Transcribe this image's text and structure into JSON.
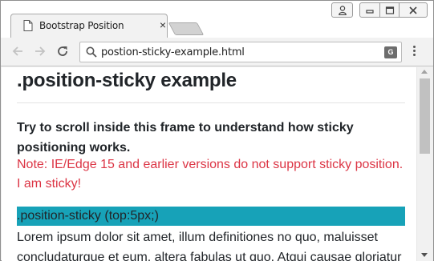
{
  "browser": {
    "tab_title": "Bootstrap Position",
    "tab_close": "×",
    "url": "postion-sticky-example.html",
    "translate_glyph": "G",
    "icons": {
      "favicon": "document-icon",
      "back": "back-arrow-icon",
      "forward": "forward-arrow-icon",
      "reload": "reload-icon",
      "search": "search-icon",
      "translate": "translate-icon",
      "menu": "more-vert-icon",
      "user": "user-icon",
      "minimize": "minimize-icon",
      "maximize": "maximize-icon",
      "close": "close-icon"
    },
    "close_button_color": "#c9c9c9"
  },
  "page": {
    "title": ".position-sticky example",
    "lead": "Try to scroll inside this frame to understand how sticky positioning works.",
    "note_line1": "Note: IE/Edge 15 and earlier versions do not support sticky position.",
    "note_line2": "I am sticky!",
    "sticky_label": ".position-sticky (top:5px;)",
    "body_line1": "Lorem ipsum dolor sit amet, illum definitiones no quo, maluisset",
    "body_line2": "concludaturque et eum, altera fabulas ut quo. Atqui causae gloriatur"
  },
  "colors": {
    "sticky_bg": "#17a2b8",
    "note_text": "#dc3545",
    "heading_text": "#212529"
  }
}
